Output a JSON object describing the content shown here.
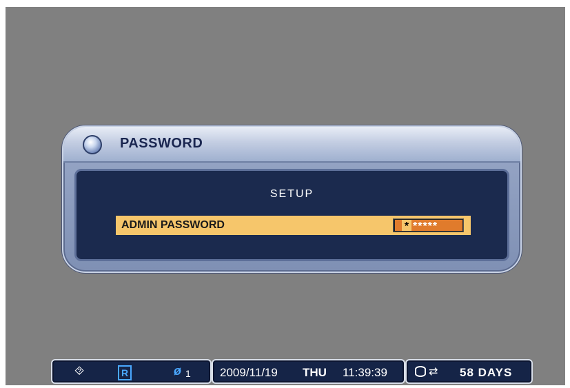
{
  "dialog": {
    "title": "PASSWORD",
    "section_label": "SETUP",
    "field_label": "ADMIN PASSWORD",
    "password_first_char": "*",
    "password_masked": "*****"
  },
  "status_bar": {
    "usb_glyph": "⯑",
    "record_glyph": "R",
    "network_glyph": "ø",
    "network_count": "1",
    "date": "2009/11/19",
    "day": "THU",
    "time": "11:39:39",
    "cycle_glyph": "⇄",
    "days_remaining": "58 DAYS"
  },
  "icons": {
    "title": "orb-icon",
    "usb": "usb-icon",
    "record": "record-icon",
    "network": "network-icon",
    "disk": "disk-icon",
    "cycle": "overwrite-cycle-icon"
  },
  "colors": {
    "screen_bg": "#808080",
    "dialog_header": "#c3cde2",
    "dialog_body": "#1b2a4e",
    "highlight_row": "#f6c66b",
    "password_fill": "#e07b2c",
    "status_bg": "#152447",
    "accent_blue": "#4aa8ff"
  }
}
